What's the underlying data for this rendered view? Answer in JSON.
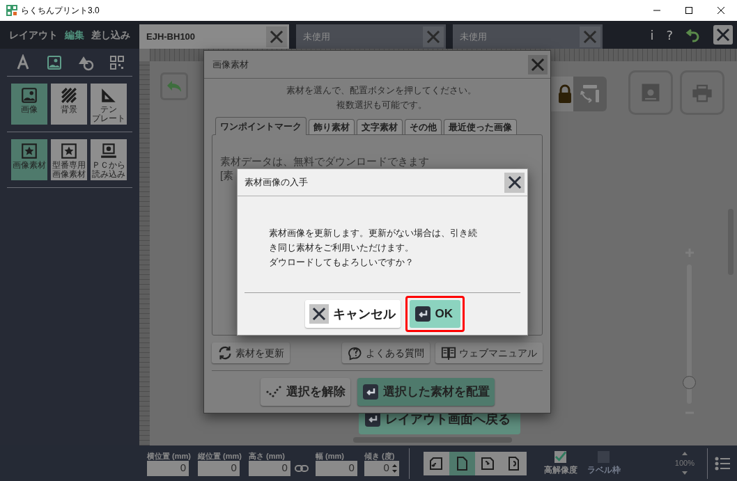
{
  "window": {
    "title": "らくちんプリント3.0"
  },
  "modes": [
    {
      "label": "レイアウト",
      "selected": false
    },
    {
      "label": "編集",
      "selected": true
    },
    {
      "label": "差し込み",
      "selected": false
    }
  ],
  "document_tabs": [
    {
      "label": "EJH-BH100",
      "selected": true
    },
    {
      "label": "未使用",
      "selected": false
    },
    {
      "label": "未使用",
      "selected": false
    }
  ],
  "header_buttons": [
    "i",
    "?"
  ],
  "sidebar": {
    "categories": [
      {
        "kind": "text",
        "selected": false
      },
      {
        "kind": "image",
        "selected": true
      },
      {
        "kind": "shape",
        "selected": false
      },
      {
        "kind": "qr",
        "selected": false
      }
    ],
    "tools": [
      {
        "kind": "image",
        "lines": [
          "画像"
        ],
        "selected": true
      },
      {
        "kind": "background",
        "lines": [
          "背景"
        ],
        "selected": false
      },
      {
        "kind": "template",
        "lines": [
          "テン",
          "プレート"
        ],
        "selected": false
      }
    ],
    "materials": [
      {
        "kind": "star",
        "lines": [
          "画像素材"
        ],
        "selected": true
      },
      {
        "kind": "star",
        "lines": [
          "型番専用",
          "画像素材"
        ],
        "selected": false
      },
      {
        "kind": "pc",
        "lines": [
          "ＰＣから",
          "読み込み"
        ],
        "selected": false
      }
    ]
  },
  "canvas": {
    "return_button": "レイアウト画面へ戻る",
    "zoom": {
      "level": 0.15
    }
  },
  "image_dialog": {
    "title": "画像素材",
    "instructions": [
      "素材を選んで、配置ボタンを押してください。",
      "複数選択も可能です。"
    ],
    "tabs": [
      {
        "label": "ワンポイントマーク",
        "selected": true
      },
      {
        "label": "飾り素材",
        "selected": false
      },
      {
        "label": "文字素材",
        "selected": false
      },
      {
        "label": "その他",
        "selected": false
      },
      {
        "label": "最近使った画像",
        "selected": false
      }
    ],
    "panel_lines": [
      "素材データは、無料でダウンロードできます",
      "[素"
    ],
    "links": [
      {
        "kind": "refresh",
        "label": "素材を更新"
      },
      {
        "kind": "faq",
        "label": "よくある質問"
      },
      {
        "kind": "manual",
        "label": "ウェブマニュアル"
      }
    ],
    "actions": [
      {
        "kind": "clear",
        "label": "選択を解除"
      },
      {
        "kind": "place",
        "label": "選択した素材を配置"
      }
    ]
  },
  "confirm_dialog": {
    "title": "素材画像の入手",
    "message": [
      "素材画像を更新します。更新がない場合は、引き続",
      "き同じ素材をご利用いただけます。",
      "ダウロードしてもよろしいですか？"
    ],
    "cancel": "キャンセル",
    "ok": "OK",
    "ok_focused": true
  },
  "status_bar": {
    "fields": [
      {
        "label": "横位置",
        "unit": "(mm)",
        "value": "0",
        "kind": "plain"
      },
      {
        "label": "縦位置",
        "unit": "(mm)",
        "value": "0",
        "kind": "plain"
      },
      {
        "label": "高さ",
        "unit": "(mm)",
        "value": "0",
        "kind": "linked"
      },
      {
        "label": "幅",
        "unit": "(mm)",
        "value": "0",
        "kind": "plain"
      },
      {
        "label": "傾き",
        "unit": "(度)",
        "value": "0",
        "kind": "spin"
      }
    ],
    "orientations": [
      {
        "kind": "rotate-left",
        "selected": false
      },
      {
        "kind": "normal",
        "selected": true
      },
      {
        "kind": "rotate-right",
        "selected": false
      },
      {
        "kind": "flip",
        "selected": false
      }
    ],
    "options": [
      {
        "label": "高解像度",
        "checked": true,
        "disabled": false
      },
      {
        "label": "ラベル枠",
        "checked": false,
        "disabled": true
      }
    ],
    "zoom": "100%"
  }
}
